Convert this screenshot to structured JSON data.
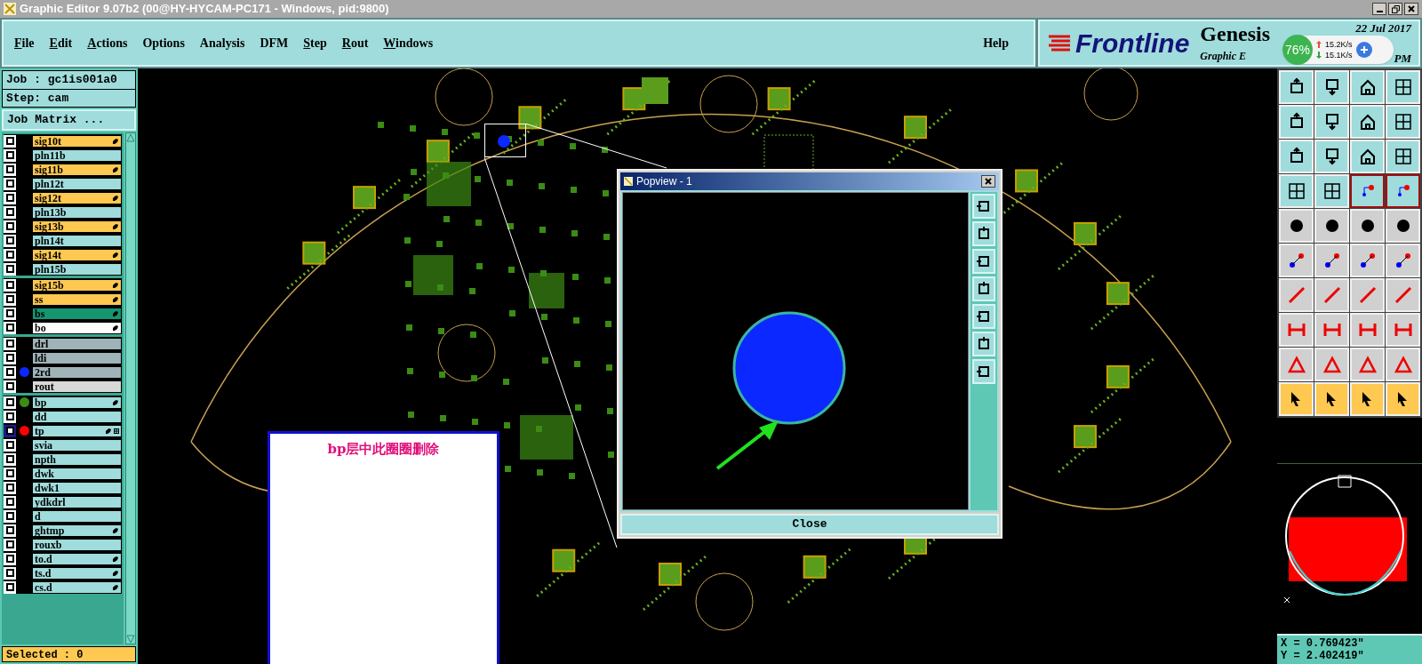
{
  "window": {
    "title": "Graphic Editor 9.07b2 (00@HY-HYCAM-PC171 - Windows, pid:9800)"
  },
  "menu": [
    {
      "label": "File",
      "underlined": true
    },
    {
      "label": "Edit",
      "underlined": true
    },
    {
      "label": "Actions",
      "underlined": true
    },
    {
      "label": "Options",
      "underlined": false
    },
    {
      "label": "Analysis",
      "underlined": false
    },
    {
      "label": "DFM",
      "underlined": false
    },
    {
      "label": "Step",
      "underlined": true
    },
    {
      "label": "Rout",
      "underlined": true
    },
    {
      "label": "Windows",
      "underlined": true
    }
  ],
  "help": "Help",
  "brand": {
    "logo": "Frontline",
    "product": "Genesis",
    "subtitle": "Graphic E",
    "date": "22 Jul 2017",
    "time": "PM"
  },
  "net_widget": {
    "percent": "76%",
    "upload": "15.2K/s",
    "download": "15.1K/s"
  },
  "job": "Job : gc1is001a0",
  "step": "Step: cam",
  "job_matrix_button": "Job Matrix ...",
  "layer_groups": [
    [
      {
        "name": "sig10t",
        "kind": "signal",
        "affected": true,
        "work": false
      },
      {
        "name": "pln11b",
        "kind": "plane",
        "affected": false,
        "work": false
      },
      {
        "name": "sig11b",
        "kind": "signal",
        "affected": true,
        "work": false
      },
      {
        "name": "pln12t",
        "kind": "plane",
        "affected": false,
        "work": false
      },
      {
        "name": "sig12t",
        "kind": "signal",
        "affected": true,
        "work": false
      },
      {
        "name": "pln13b",
        "kind": "plane",
        "affected": false,
        "work": false
      },
      {
        "name": "sig13b",
        "kind": "signal",
        "affected": true,
        "work": false
      },
      {
        "name": "pln14t",
        "kind": "plane",
        "affected": false,
        "work": false
      },
      {
        "name": "sig14t",
        "kind": "signal",
        "affected": true,
        "work": false
      },
      {
        "name": "pln15b",
        "kind": "plane",
        "affected": false,
        "work": false
      }
    ],
    [
      {
        "name": "sig15b",
        "kind": "signal",
        "affected": true,
        "work": false
      },
      {
        "name": "ss",
        "kind": "silk",
        "affected": true,
        "work": false
      },
      {
        "name": "bs",
        "kind": "mask",
        "affected": true,
        "work": false
      },
      {
        "name": "bo",
        "kind": "outline",
        "affected": true,
        "work": false
      }
    ],
    [
      {
        "name": "drl",
        "kind": "drill",
        "affected": false,
        "work": false
      },
      {
        "name": "ldi",
        "kind": "drill",
        "affected": false,
        "work": false
      },
      {
        "name": "2rd",
        "kind": "drill",
        "affected": false,
        "work": false,
        "color": "#0a28ff"
      },
      {
        "name": "rout",
        "kind": "rout",
        "affected": false,
        "work": false
      }
    ],
    [
      {
        "name": "bp",
        "kind": "doc",
        "affected": true,
        "work": false,
        "color": "#3c8c14"
      },
      {
        "name": "dd",
        "kind": "doc",
        "affected": false,
        "work": false
      },
      {
        "name": "tp",
        "kind": "doc",
        "affected": true,
        "work": true,
        "color": "#ff0000"
      },
      {
        "name": "svia",
        "kind": "doc",
        "affected": false,
        "work": false
      },
      {
        "name": "npth",
        "kind": "doc",
        "affected": false,
        "work": false
      },
      {
        "name": "dwk",
        "kind": "doc",
        "affected": false,
        "work": false
      },
      {
        "name": "dwk1",
        "kind": "doc",
        "affected": false,
        "work": false
      },
      {
        "name": "ydkdrl",
        "kind": "doc",
        "affected": false,
        "work": false
      },
      {
        "name": "d",
        "kind": "doc",
        "affected": false,
        "work": false
      },
      {
        "name": "ghtmp",
        "kind": "doc",
        "affected": true,
        "work": false
      },
      {
        "name": "rouxb",
        "kind": "doc",
        "affected": false,
        "work": false
      },
      {
        "name": "to.d",
        "kind": "doc",
        "affected": true,
        "work": false
      },
      {
        "name": "ts.d",
        "kind": "doc",
        "affected": true,
        "work": false
      },
      {
        "name": "cs.d",
        "kind": "doc",
        "affected": true,
        "work": false
      }
    ]
  ],
  "selected_count": "Selected : 0",
  "popview": {
    "title": "Popview - 1",
    "close_button": "Close"
  },
  "note": "bp层中此圈圈删除",
  "coords": {
    "x": "X = 0.769423\"",
    "y": "Y = 2.402419\""
  }
}
